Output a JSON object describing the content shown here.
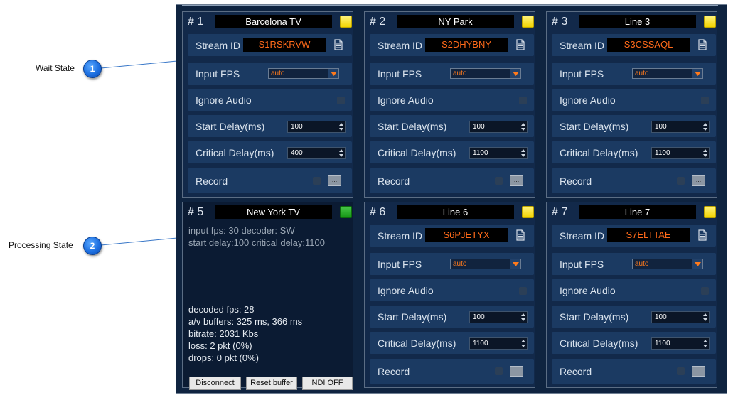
{
  "annotations": [
    {
      "label": "Wait State",
      "number": "1"
    },
    {
      "label": "Processing State",
      "number": "2"
    }
  ],
  "common": {
    "stream_id_label": "Stream ID",
    "input_fps_label": "Input FPS",
    "ignore_audio_label": "Ignore Audio",
    "start_delay_label": "Start Delay(ms)",
    "critical_delay_label": "Critical Delay(ms)",
    "record_label": "Record",
    "record_button": "...",
    "copy_icon": "copy-document-icon"
  },
  "colors": {
    "status_waiting": "#f2d400",
    "status_processing": "#159515",
    "stream_id_text": "#ff6a1a"
  },
  "panels": [
    {
      "number": "# 1",
      "name": "Barcelona TV",
      "status": "waiting",
      "stream_id": "S1RSKRVW",
      "input_fps": "auto",
      "start_delay": "100",
      "critical_delay": "400"
    },
    {
      "number": "# 2",
      "name": "NY Park",
      "status": "waiting",
      "stream_id": "S2DHYBNY",
      "input_fps": "auto",
      "start_delay": "100",
      "critical_delay": "1100"
    },
    {
      "number": "# 3",
      "name": "Line 3",
      "status": "waiting",
      "stream_id": "S3CSSAQL",
      "input_fps": "auto",
      "start_delay": "100",
      "critical_delay": "1100"
    },
    {
      "number": "# 5",
      "name": "New York TV",
      "status": "processing"
    },
    {
      "number": "# 6",
      "name": "Line 6",
      "status": "waiting",
      "stream_id": "S6PJETYX",
      "input_fps": "auto",
      "start_delay": "100",
      "critical_delay": "1100"
    },
    {
      "number": "# 7",
      "name": "Line 7",
      "status": "waiting",
      "stream_id": "S7ELTTAE",
      "input_fps": "auto",
      "start_delay": "100",
      "critical_delay": "1100"
    }
  ],
  "processing": {
    "info_line1": "input fps: 30  decoder: SW",
    "info_line2": "start delay:100  critical delay:1100",
    "decoded_fps": "decoded fps: 28",
    "av_buffers": "a/v buffers: 325 ms, 366 ms",
    "bitrate": "bitrate: 2031 Kbs",
    "loss": "loss: 2 pkt (0%)",
    "drops": "drops: 0 pkt (0%)",
    "disconnect_button": "Disconnect",
    "reset_buffer_button": "Reset buffer",
    "ndi_button": "NDI OFF"
  }
}
